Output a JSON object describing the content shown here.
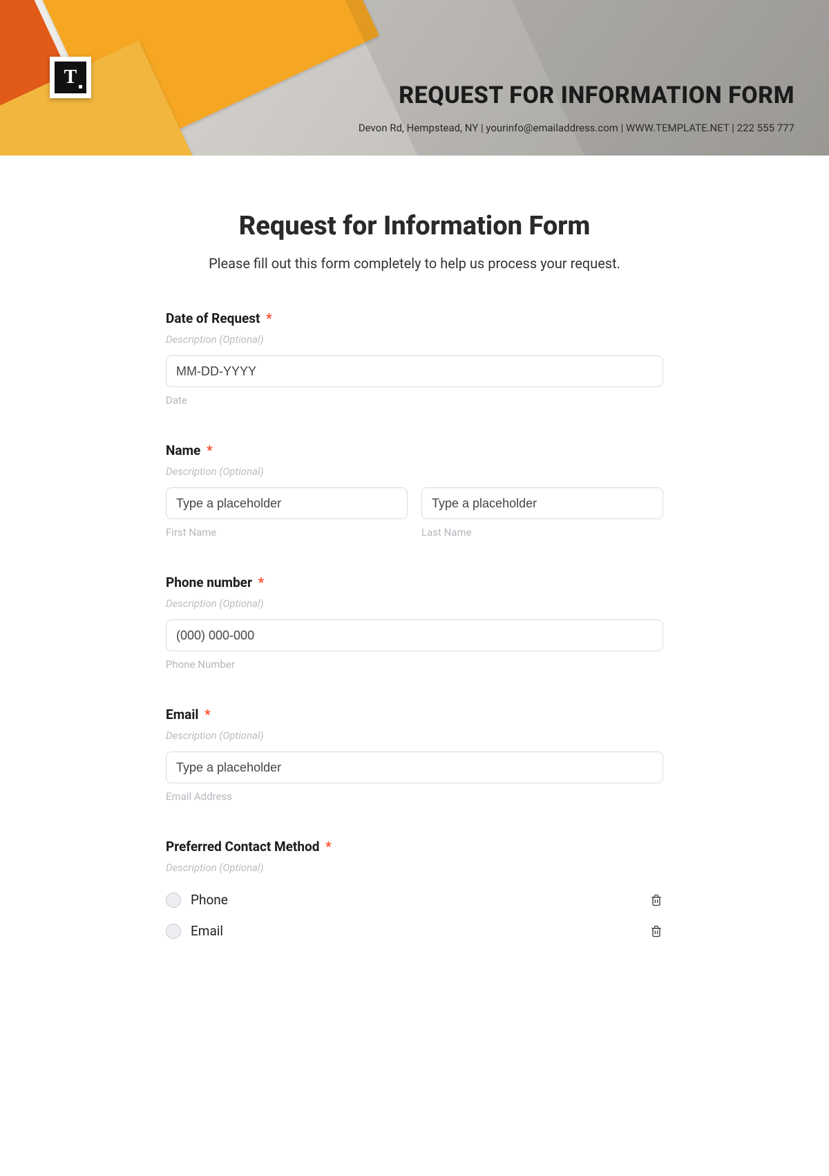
{
  "banner": {
    "logo_letter": "T",
    "title": "REQUEST FOR INFORMATION FORM",
    "subtitle": "Devon Rd, Hempstead, NY | yourinfo@emailaddress.com | WWW.TEMPLATE.NET | 222 555 777"
  },
  "form": {
    "title": "Request for Information Form",
    "subtitle": "Please fill out this form completely to help us process your request.",
    "description_placeholder": "Description (Optional)",
    "required_mark": "*",
    "fields": {
      "date": {
        "label": "Date of Request",
        "placeholder": "MM-DD-YYYY",
        "sublabel": "Date"
      },
      "name": {
        "label": "Name",
        "first_placeholder": "Type a placeholder",
        "last_placeholder": "Type a placeholder",
        "first_sublabel": "First Name",
        "last_sublabel": "Last Name"
      },
      "phone": {
        "label": "Phone number",
        "placeholder": "(000) 000-000",
        "sublabel": "Phone Number"
      },
      "email": {
        "label": "Email",
        "placeholder": "Type a placeholder",
        "sublabel": "Email Address"
      },
      "contact_method": {
        "label": "Preferred Contact Method",
        "options": [
          "Phone",
          "Email"
        ]
      }
    }
  }
}
